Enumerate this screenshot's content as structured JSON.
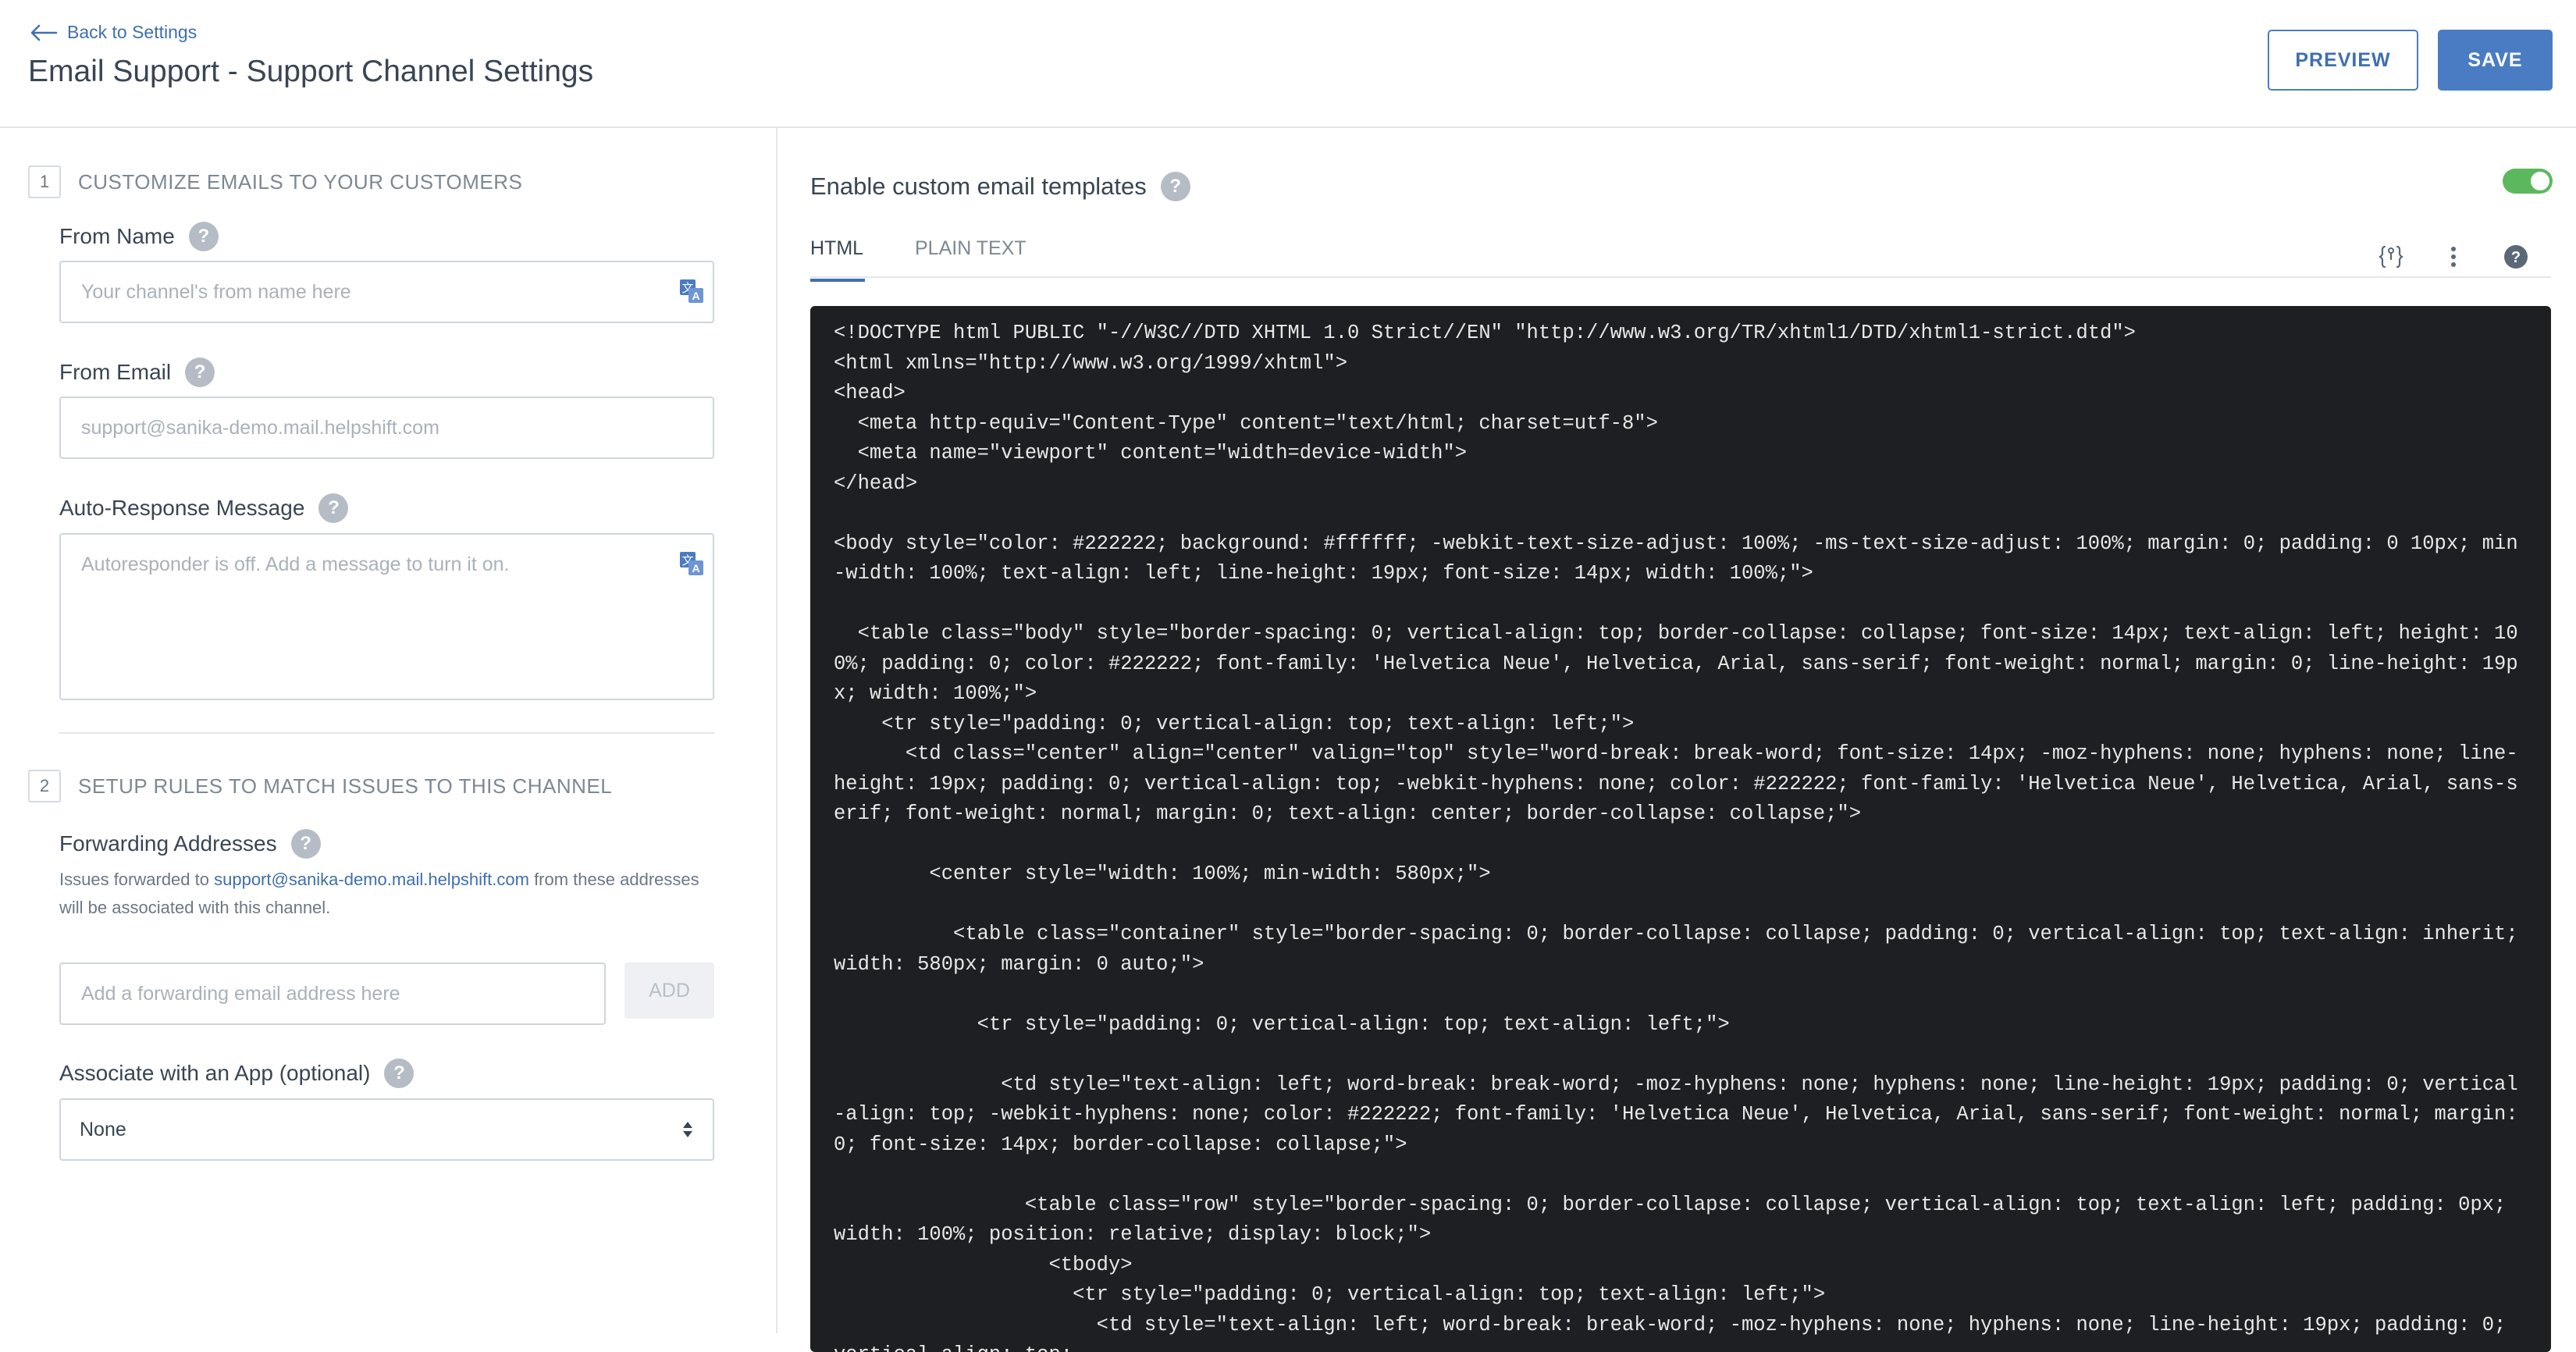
{
  "header": {
    "back_label": "Back to Settings",
    "title": "Email Support - Support Channel Settings",
    "preview_label": "PREVIEW",
    "save_label": "SAVE"
  },
  "left": {
    "section1": {
      "number": "1",
      "title": "CUSTOMIZE EMAILS TO YOUR CUSTOMERS"
    },
    "from_name": {
      "label": "From Name",
      "help": "?",
      "placeholder": "Your channel's from name here"
    },
    "from_email": {
      "label": "From Email",
      "help": "?",
      "placeholder": "support@sanika-demo.mail.helpshift.com"
    },
    "auto_response": {
      "label": "Auto-Response Message",
      "help": "?",
      "placeholder": "Autoresponder is off. Add a message to turn it on."
    },
    "section2": {
      "number": "2",
      "title": "SETUP RULES TO MATCH ISSUES TO THIS CHANNEL"
    },
    "forwarding": {
      "label": "Forwarding Addresses",
      "help": "?",
      "desc_prefix": "Issues forwarded to ",
      "desc_link": "support@sanika-demo.mail.helpshift.com",
      "desc_suffix": " from these addresses will be associated with this channel.",
      "placeholder": "Add a forwarding email address here",
      "add_label": "ADD"
    },
    "associate_app": {
      "label": "Associate with an App (optional)",
      "help": "?",
      "selected": "None"
    }
  },
  "right": {
    "enable_label": "Enable custom email templates",
    "help": "?",
    "toggle_on": true,
    "tabs": [
      {
        "label": "HTML",
        "active": true
      },
      {
        "label": "PLAIN TEXT",
        "active": false
      }
    ],
    "code": "<!DOCTYPE html PUBLIC \"-//W3C//DTD XHTML 1.0 Strict//EN\" \"http://www.w3.org/TR/xhtml1/DTD/xhtml1-strict.dtd\">\n<html xmlns=\"http://www.w3.org/1999/xhtml\">\n<head>\n  <meta http-equiv=\"Content-Type\" content=\"text/html; charset=utf-8\">\n  <meta name=\"viewport\" content=\"width=device-width\">\n</head>\n\n<body style=\"color: #222222; background: #ffffff; -webkit-text-size-adjust: 100%; -ms-text-size-adjust: 100%; margin: 0; padding: 0 10px; min-width: 100%; text-align: left; line-height: 19px; font-size: 14px; width: 100%;\">\n\n  <table class=\"body\" style=\"border-spacing: 0; vertical-align: top; border-collapse: collapse; font-size: 14px; text-align: left; height: 100%; padding: 0; color: #222222; font-family: 'Helvetica Neue', Helvetica, Arial, sans-serif; font-weight: normal; margin: 0; line-height: 19px; width: 100%;\">\n    <tr style=\"padding: 0; vertical-align: top; text-align: left;\">\n      <td class=\"center\" align=\"center\" valign=\"top\" style=\"word-break: break-word; font-size: 14px; -moz-hyphens: none; hyphens: none; line-height: 19px; padding: 0; vertical-align: top; -webkit-hyphens: none; color: #222222; font-family: 'Helvetica Neue', Helvetica, Arial, sans-serif; font-weight: normal; margin: 0; text-align: center; border-collapse: collapse;\">\n\n        <center style=\"width: 100%; min-width: 580px;\">\n\n          <table class=\"container\" style=\"border-spacing: 0; border-collapse: collapse; padding: 0; vertical-align: top; text-align: inherit; width: 580px; margin: 0 auto;\">\n\n            <tr style=\"padding: 0; vertical-align: top; text-align: left;\">\n\n              <td style=\"text-align: left; word-break: break-word; -moz-hyphens: none; hyphens: none; line-height: 19px; padding: 0; vertical-align: top; -webkit-hyphens: none; color: #222222; font-family: 'Helvetica Neue', Helvetica, Arial, sans-serif; font-weight: normal; margin: 0; font-size: 14px; border-collapse: collapse;\">\n\n                <table class=\"row\" style=\"border-spacing: 0; border-collapse: collapse; vertical-align: top; text-align: left; padding: 0px; width: 100%; position: relative; display: block;\">\n                  <tbody>\n                    <tr style=\"padding: 0; vertical-align: top; text-align: left;\">\n                      <td style=\"text-align: left; word-break: break-word; -moz-hyphens: none; hyphens: none; line-height: 19px; padding: 0; vertical-align: top;"
  },
  "colors": {
    "accent": "#4a7cc3",
    "toggle_on": "#5cb85c",
    "editor_bg": "#1e1f22"
  },
  "icons": [
    "back-arrow-icon",
    "translate-icon",
    "help-icon",
    "select-arrows-icon",
    "code-braces-icon",
    "more-vertical-icon",
    "help-circle-icon"
  ]
}
